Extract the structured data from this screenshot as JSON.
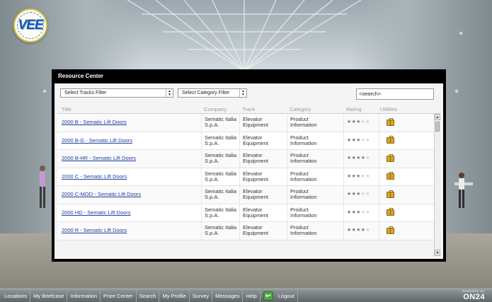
{
  "logo": {
    "text": "VEE"
  },
  "panel": {
    "title": "Resource Center",
    "filters": {
      "tracks_selected": "Select Tracks Filter",
      "category_selected": "Select Category Filter"
    },
    "search": {
      "value": "<search>"
    },
    "columns": [
      "Title",
      "Company",
      "Track",
      "Category",
      "Rating",
      "Utilities"
    ],
    "rows": [
      {
        "title": "2000 B - Sematic Lift Doors",
        "company_l1": "Sematic Italia",
        "company_l2": "S.p.A.",
        "track_l1": "Elevator",
        "track_l2": "Equipment",
        "category_l1": "Product",
        "category_l2": "Information",
        "rating": 3
      },
      {
        "title": "2000 B-G - Sematic Lift Doors",
        "company_l1": "Sematic Italia",
        "company_l2": "S.p.A.",
        "track_l1": "Elevator",
        "track_l2": "Equipment",
        "category_l1": "Product",
        "category_l2": "Information",
        "rating": 3
      },
      {
        "title": "2000 B-HR - Sematic Lift Doors",
        "company_l1": "Sematic Italia",
        "company_l2": "S.p.A.",
        "track_l1": "Elevator",
        "track_l2": "Equipment",
        "category_l1": "Product",
        "category_l2": "Information",
        "rating": 4
      },
      {
        "title": "2000 C - Sematic Lift Doors",
        "company_l1": "Sematic Italia",
        "company_l2": "S.p.A.",
        "track_l1": "Elevator",
        "track_l2": "Equipment",
        "category_l1": "Product",
        "category_l2": "Information",
        "rating": 3
      },
      {
        "title": "2000 C-MOD - Sematic Lift Doors",
        "company_l1": "Sematic Italia",
        "company_l2": "S.p.A.",
        "track_l1": "Elevator",
        "track_l2": "Equipment",
        "category_l1": "Product",
        "category_l2": "Information",
        "rating": 3
      },
      {
        "title": "2000 HD - Sematic Lift Doors",
        "company_l1": "Sematic Italia",
        "company_l2": "S.p.A.",
        "track_l1": "Elevator",
        "track_l2": "Equipment",
        "category_l1": "Product",
        "category_l2": "Information",
        "rating": 3
      },
      {
        "title": "2000 R - Sematic Lift Doors",
        "company_l1": "Sematic Italia",
        "company_l2": "S.p.A.",
        "track_l1": "Elevator",
        "track_l2": "Equipment",
        "category_l1": "Product",
        "category_l2": "Information",
        "rating": 4
      }
    ],
    "rating_max": 5,
    "utility_icon": "briefcase-icon"
  },
  "nav": {
    "items": [
      "Locations",
      "My Briefcase",
      "Information",
      "Prize Center",
      "Search",
      "My Profile",
      "Survey",
      "Messages",
      "Help"
    ],
    "logout": "Logout",
    "exit_icon": "exit-icon"
  },
  "brand": {
    "powered_by": "POWERED BY",
    "name": "ON24"
  },
  "colors": {
    "panel_bg": "#000000",
    "link": "#1d3fa0",
    "nav_bg": "#6f777a",
    "exit_green": "#4fa642",
    "briefcase": "#d9a325"
  }
}
